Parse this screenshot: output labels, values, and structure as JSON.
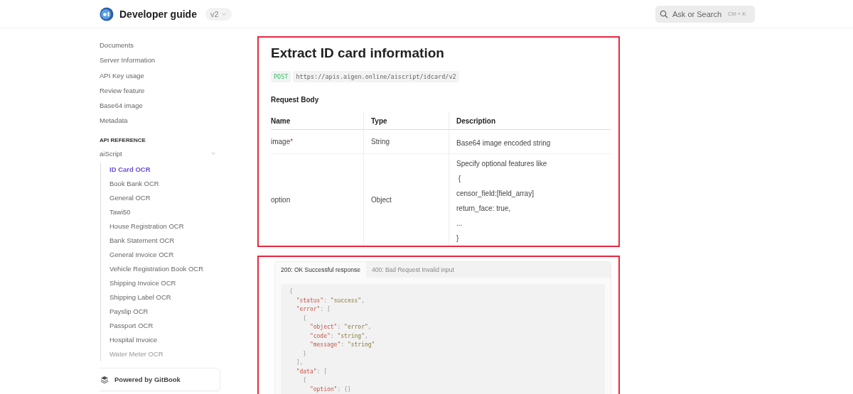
{
  "header": {
    "title": "Developer guide",
    "version": "v2",
    "search": {
      "placeholder": "Ask or Search",
      "shortcut": "Ctrl + K"
    }
  },
  "sidebar": {
    "items": [
      {
        "label": "Documents",
        "selected": false
      },
      {
        "label": "Server Information",
        "selected": false
      },
      {
        "label": "API Key usage",
        "selected": false
      },
      {
        "label": "Review feature",
        "selected": false
      },
      {
        "label": "Base64 image",
        "selected": false
      },
      {
        "label": "Metadata",
        "selected": false
      }
    ],
    "section_title": "API REFERENCE",
    "group": {
      "label": "aiScript",
      "expanded": true,
      "children": [
        {
          "label": "ID Card OCR",
          "selected": true
        },
        {
          "label": "Book Bank OCR",
          "selected": false
        },
        {
          "label": "General OCR",
          "selected": false
        },
        {
          "label": "Tawi50",
          "selected": false
        },
        {
          "label": "House Registration OCR",
          "selected": false
        },
        {
          "label": "Bank Statement OCR",
          "selected": false
        },
        {
          "label": "General Invoice OCR",
          "selected": false
        },
        {
          "label": "Vehicle Registration Book OCR",
          "selected": false
        },
        {
          "label": "Shipping Invoice OCR",
          "selected": false
        },
        {
          "label": "Shipping Label OCR",
          "selected": false
        },
        {
          "label": "Payslip OCR",
          "selected": false
        },
        {
          "label": "Passport OCR",
          "selected": false
        },
        {
          "label": "Hospital Invoice",
          "selected": false
        },
        {
          "label": "Water Meter OCR",
          "selected": false
        }
      ]
    },
    "footer": "Powered by GitBook"
  },
  "request": {
    "highlighted": true,
    "title": "Extract ID card information",
    "method": "POST",
    "url": "https://apis.aigen.online/aiscript/idcard/v2",
    "body_title": "Request Body",
    "required_mark": "*",
    "columns": [
      "Name",
      "Type",
      "Description"
    ],
    "rows": [
      {
        "name": "image",
        "required": true,
        "type": "String",
        "description": [
          "Base64 image encoded string"
        ]
      },
      {
        "name": "option",
        "required": false,
        "type": "Object",
        "description": [
          "Specify optional features like",
          " {",
          "censor_field:[field_array]",
          "return_face: true,",
          "...",
          "}"
        ]
      }
    ]
  },
  "response": {
    "highlighted": true,
    "tabs": [
      {
        "label": "200: OK Successful response",
        "selected": true
      },
      {
        "label": "400: Bad Request Invalid input",
        "selected": false
      }
    ],
    "code": [
      "{",
      "  \"status\": \"success\",",
      "  \"error\": [",
      "    {",
      "      \"object\": \"error\",",
      "      \"code\": \"string\",",
      "      \"message\": \"string\"",
      "    }",
      "  ],",
      "  \"data\": [",
      "    {",
      "      \"option\": {}"
    ]
  }
}
